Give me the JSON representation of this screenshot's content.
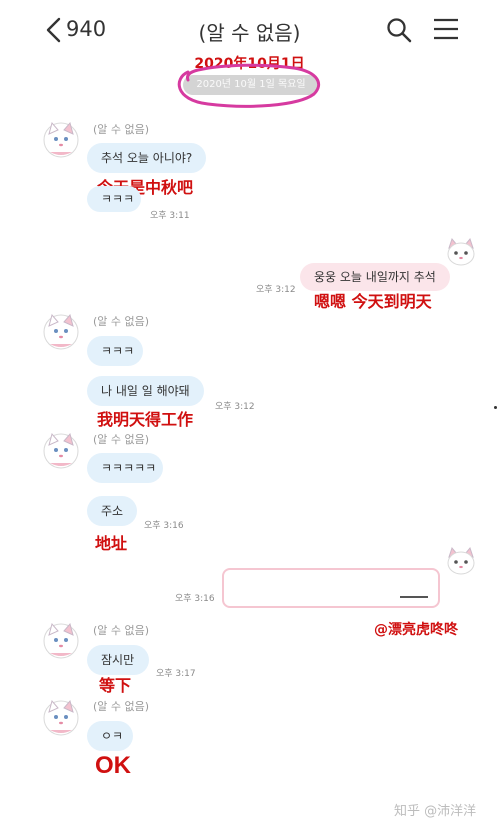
{
  "header": {
    "unread_count": "940",
    "title": "(알 수 없음)"
  },
  "date_annotation": "2020年10月1日",
  "date_pill": "2020년 10월 1일 목요일",
  "messages": [
    {
      "sender": "(알 수 없음)",
      "text": "추석 오늘 아니야?",
      "translation": "今天是中秋吧"
    },
    {
      "text": "ㅋㅋㅋ",
      "time": "오후 3:11"
    },
    {
      "text": "웅웅 오늘 내일까지 추석",
      "time": "오후 3:12",
      "translation": "嗯嗯  今天到明天"
    },
    {
      "sender": "(알 수 없음)",
      "text": "ㅋㅋㅋ"
    },
    {
      "text": "나 내일 일 해야돼",
      "time": "오후 3:12",
      "translation": "我明天得工作"
    },
    {
      "sender": "(알 수 없음)",
      "text": "ㅋㅋㅋㅋㅋ"
    },
    {
      "text": "주소",
      "time": "오후 3:16",
      "translation": "地址"
    },
    {
      "time": "오후 3:16",
      "translation": "@漂亮虎咚咚"
    },
    {
      "sender": "(알 수 없음)",
      "text": "잠시만",
      "time": "오후 3:17",
      "translation": "等下"
    },
    {
      "sender": "(알 수 없음)",
      "text": "ㅇㅋ",
      "translation": "OK"
    }
  ],
  "watermark": "知乎 @沛洋洋",
  "colors": {
    "incoming_bubble": "#e3f1fb",
    "outgoing_bubble": "#fbe5ea",
    "annotation_red": "#d01010",
    "circle_magenta": "#d63aa0"
  },
  "icons": [
    "back-chevron-icon",
    "search-icon",
    "menu-icon",
    "cat-avatar-icon"
  ]
}
